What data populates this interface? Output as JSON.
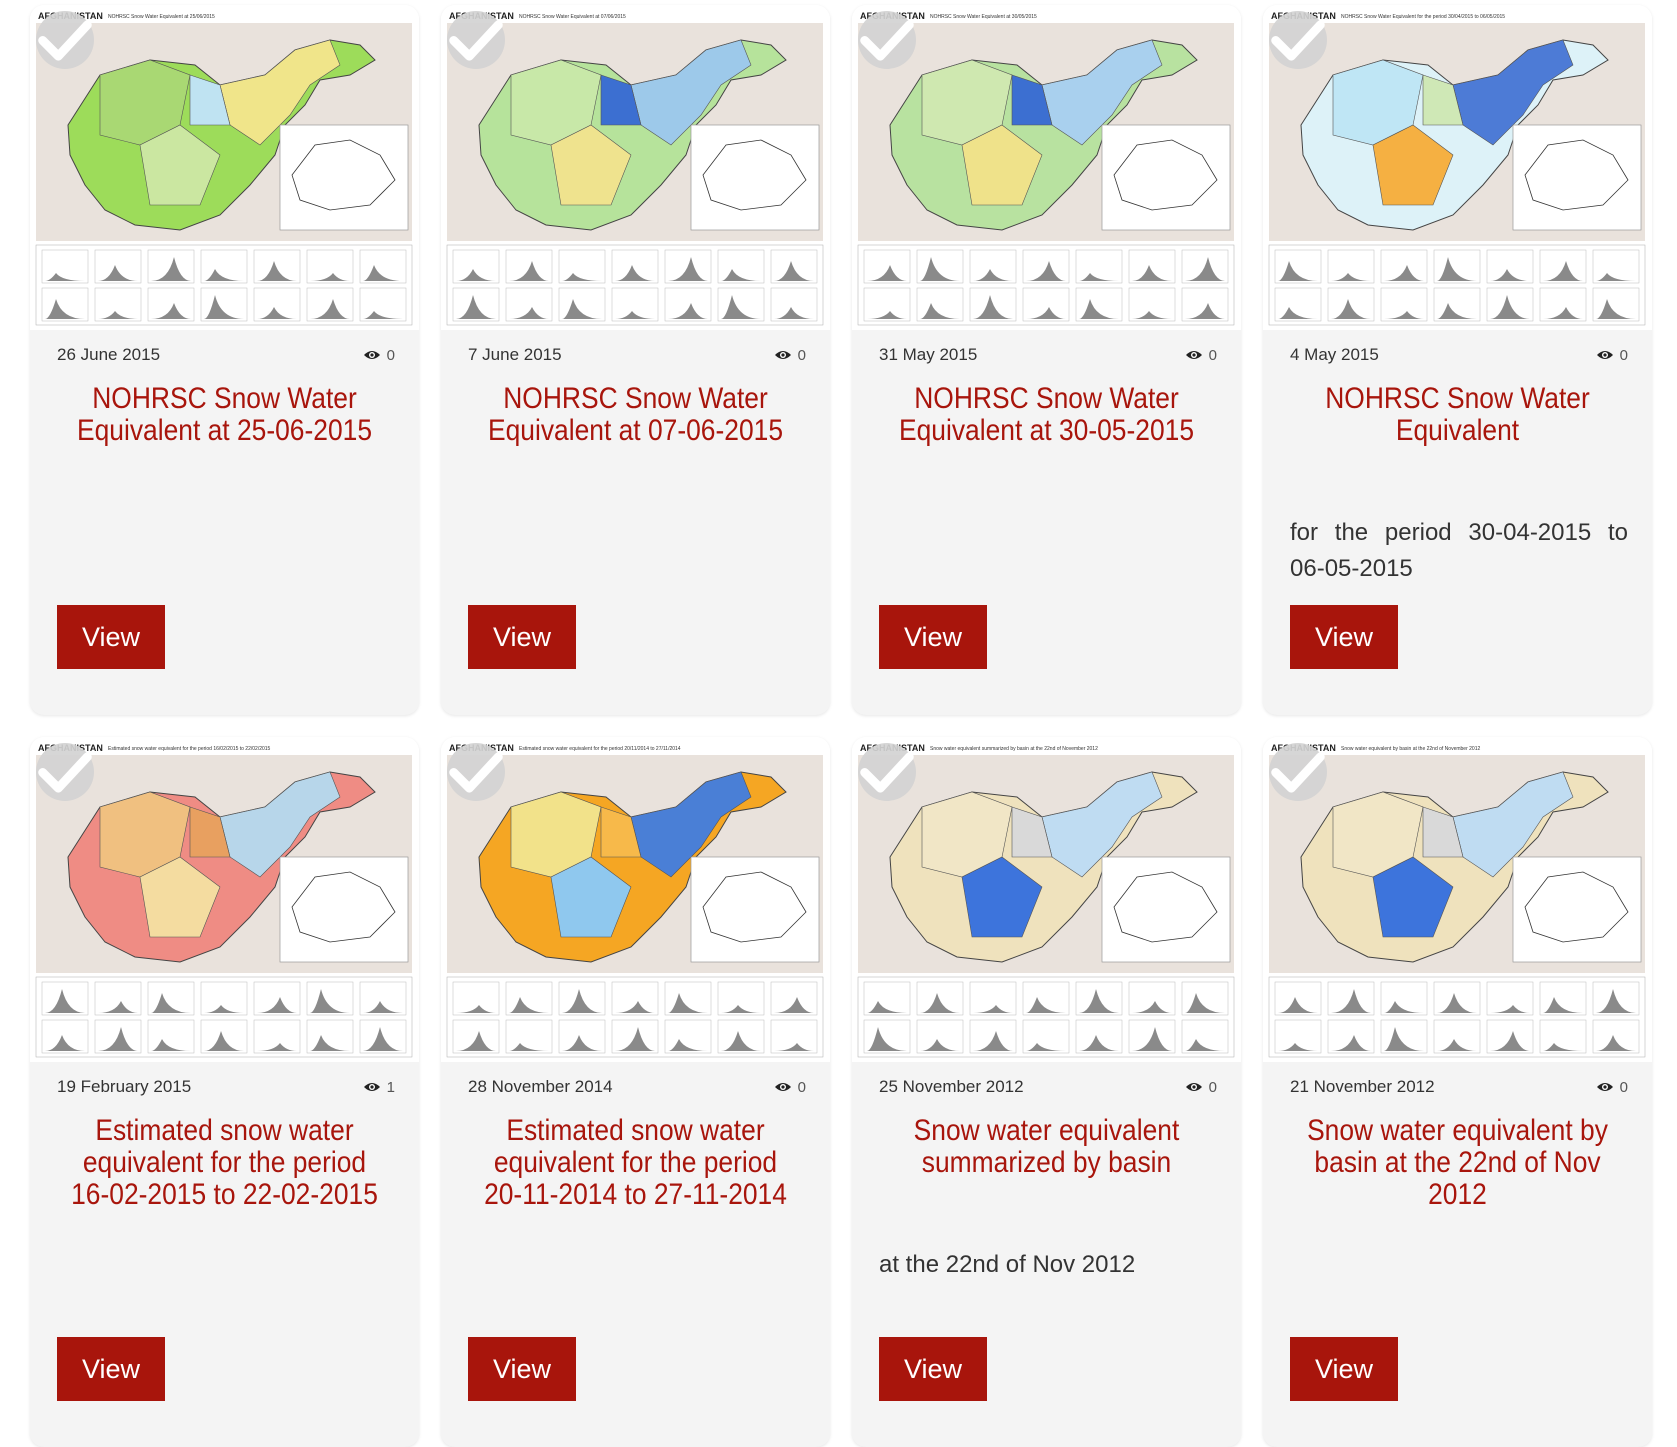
{
  "cards": [
    {
      "date": "26 June 2015",
      "views": "0",
      "title": "NOHRSC Snow Water Equivalent at 25-06-2015",
      "description": "",
      "button": "View",
      "thumb_header": "AFGHANISTAN",
      "thumb_subtitle": "NOHRSC Snow Water Equivalent at 25/06/2015",
      "map_colors": [
        "#9ddc5a",
        "#a9d873",
        "#cbe7a1",
        "#f0e58a",
        "#bfe3f2"
      ]
    },
    {
      "date": "7 June 2015",
      "views": "0",
      "title": "NOHRSC Snow Water Equivalent at 07-06-2015",
      "description": "",
      "button": "View",
      "thumb_header": "AFGHANISTAN",
      "thumb_subtitle": "NOHRSC Snow Water Equivalent at 07/06/2015",
      "map_colors": [
        "#b6e39b",
        "#c8e8a8",
        "#efe38e",
        "#9dc9ea",
        "#3c6fd1"
      ]
    },
    {
      "date": "31 May 2015",
      "views": "0",
      "title": "NOHRSC Snow Water Equivalent at 30-05-2015",
      "description": "",
      "button": "View",
      "thumb_header": "AFGHANISTAN",
      "thumb_subtitle": "NOHRSC Snow Water Equivalent at 30/05/2015",
      "map_colors": [
        "#b8e2a0",
        "#cfe8b0",
        "#efe28a",
        "#a9d0ee",
        "#3c6fd1"
      ]
    },
    {
      "date": "4 May 2015",
      "views": "0",
      "title": "NOHRSC Snow Water Equivalent",
      "description": "for the period 30-04-2015 to 06-05-2015",
      "button": "View",
      "thumb_header": "AFGHANISTAN",
      "thumb_subtitle": "NOHRSC Snow Water Equivalent for the period 30/04/2015 to 06/05/2015",
      "map_colors": [
        "#ddf2f8",
        "#bfe6f5",
        "#f5b042",
        "#4d7bd6",
        "#cfe8b6"
      ]
    },
    {
      "date": "19 February 2015",
      "views": "1",
      "title": "Estimated snow water equivalent for the period 16-02-2015 to 22-02-2015",
      "description": "",
      "button": "View",
      "thumb_header": "AFGHANISTAN",
      "thumb_subtitle": "Estimated snow water equivalent for the period 16/02/2015 to 22/02/2015",
      "map_colors": [
        "#ef8c84",
        "#f0c080",
        "#f4dca0",
        "#b7d6ea",
        "#e8a060"
      ]
    },
    {
      "date": "28 November 2014",
      "views": "0",
      "title": "Estimated snow water equivalent for the period 20-11-2014 to 27-11-2014",
      "description": "",
      "button": "View",
      "thumb_header": "AFGHANISTAN",
      "thumb_subtitle": "Estimated snow water equivalent for the period 20/11/2014 to 27/11/2014",
      "map_colors": [
        "#f5a623",
        "#f2e28a",
        "#8fc8ee",
        "#4a7fd6",
        "#f7b94a"
      ]
    },
    {
      "date": "25 November 2012",
      "views": "0",
      "title": "Snow water equivalent summarized by basin",
      "description": "at the 22nd of Nov 2012",
      "button": "View",
      "thumb_header": "AFGHANISTAN",
      "thumb_subtitle": "Snow water equivalent summarized by basin at the 22nd of November 2012",
      "map_colors": [
        "#efe2bd",
        "#f1e6c6",
        "#3d74dc",
        "#bfdcf2",
        "#d9d9d9"
      ]
    },
    {
      "date": "21 November 2012",
      "views": "0",
      "title": "Snow water equivalent by basin at the 22nd of Nov 2012",
      "description": "",
      "button": "View",
      "thumb_header": "AFGHANISTAN",
      "thumb_subtitle": "Snow water equivalent by basin at the 22nd of November 2012",
      "map_colors": [
        "#efe2bd",
        "#f1e6c6",
        "#3d74dc",
        "#bfdcf2",
        "#d9d9d9"
      ]
    }
  ],
  "theme": {
    "accent": "#a8150c",
    "card_bg": "#f4f4f4"
  }
}
